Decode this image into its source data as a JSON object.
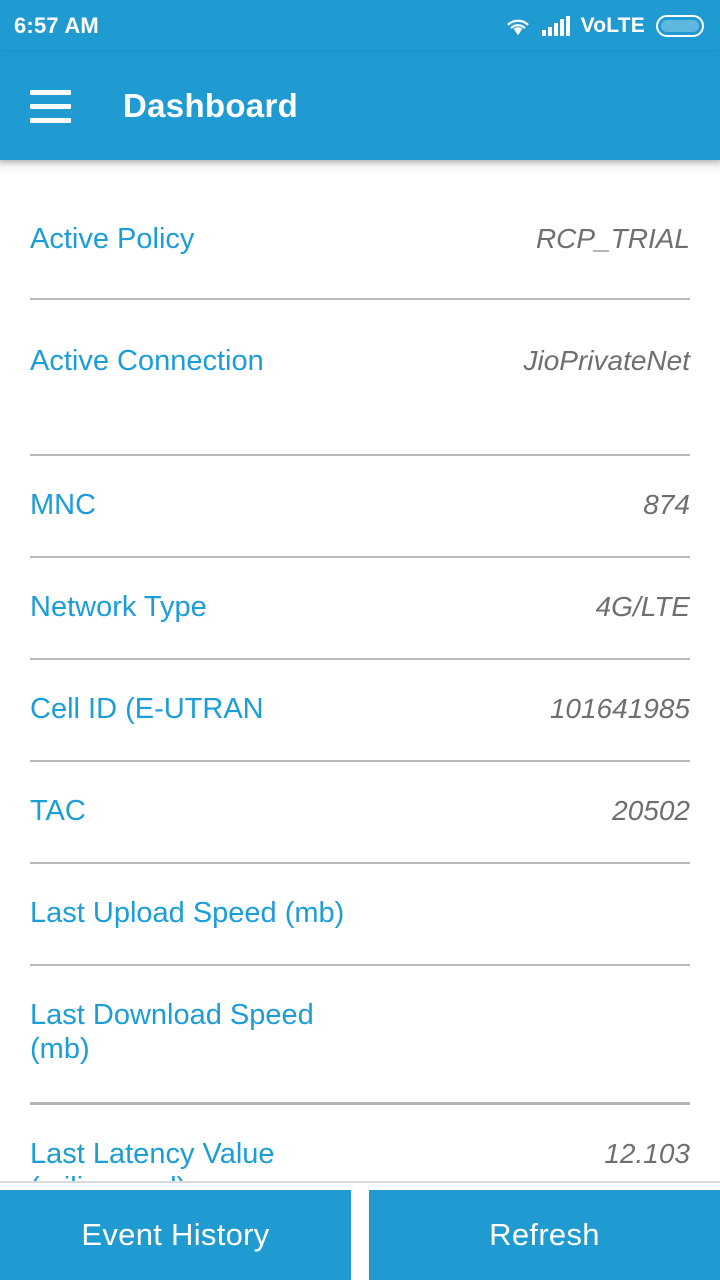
{
  "status_bar": {
    "time": "6:57 AM",
    "wifi_icon": "wifi-icon",
    "signal_icon": "signal-bars-icon",
    "volte_label": "VoLTE",
    "battery_icon": "battery-icon"
  },
  "app_bar": {
    "menu_icon": "hamburger-menu-icon",
    "title": "Dashboard"
  },
  "colors": {
    "brand_blue": "#1f9bd1",
    "label_blue": "#1b9dd9",
    "value_gray": "#6f6f6f",
    "divider_gray": "#b7b8ba"
  },
  "details": [
    {
      "label": "Active Policy",
      "value": "RCP_TRIAL"
    },
    {
      "label": "Active Connection",
      "value": "JioPrivateNet"
    },
    {
      "label": "MNC",
      "value": "874"
    },
    {
      "label": "Network Type",
      "value": "4G/LTE"
    },
    {
      "label": "Cell ID (E-UTRAN",
      "value": "101641985"
    },
    {
      "label": "TAC",
      "value": "20502"
    },
    {
      "label": "Last Upload Speed (mb)",
      "value": ""
    },
    {
      "label": "Last Download Speed (mb)",
      "value": ""
    },
    {
      "label": "Last Latency Value (milisecond)",
      "value": "12.103"
    }
  ],
  "bottom_bar": {
    "event_history_label": "Event History",
    "refresh_label": "Refresh"
  }
}
